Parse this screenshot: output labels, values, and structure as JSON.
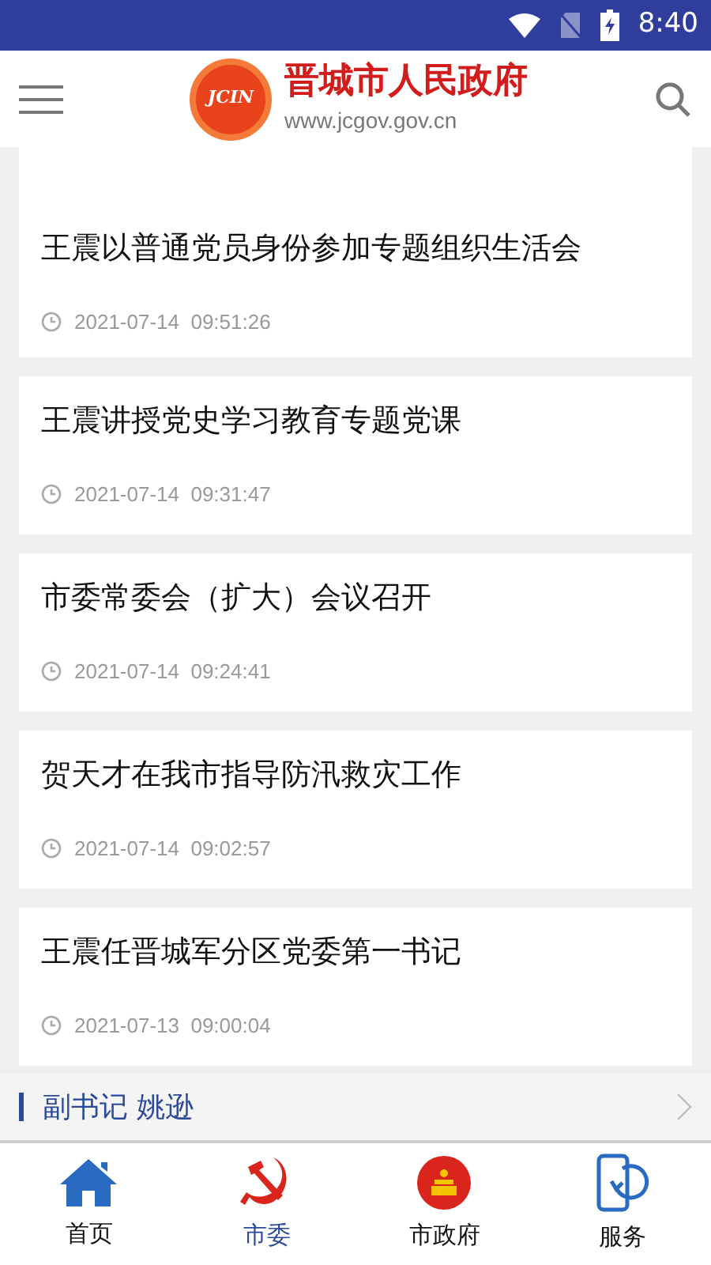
{
  "status_bar": {
    "time": "8:40"
  },
  "header": {
    "logo_text": "JCIN",
    "title": "晋城市人民政府",
    "url": "www.jcgov.gov.cn"
  },
  "articles": [
    {
      "title": "王震以普通党员身份参加专题组织生活会",
      "date": "2021-07-14  09:51:26"
    },
    {
      "title": "王震讲授党史学习教育专题党课",
      "date": "2021-07-14  09:31:47"
    },
    {
      "title": "市委常委会（扩大）会议召开",
      "date": "2021-07-14  09:24:41"
    },
    {
      "title": "贺天才在我市指导防汛救灾工作",
      "date": "2021-07-14  09:02:57"
    },
    {
      "title": "王震任晋城军分区党委第一书记",
      "date": "2021-07-13  09:00:04"
    }
  ],
  "section": {
    "title": "副书记 姚逊"
  },
  "tabs": [
    {
      "label": "首页",
      "kind": "home",
      "selected": false
    },
    {
      "label": "市委",
      "kind": "party",
      "selected": true
    },
    {
      "label": "市政府",
      "kind": "emblem",
      "selected": false
    },
    {
      "label": "服务",
      "kind": "service",
      "selected": false
    }
  ]
}
